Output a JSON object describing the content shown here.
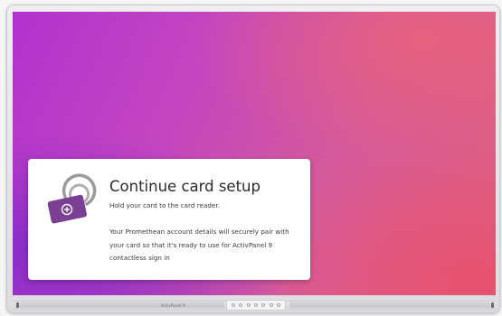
{
  "dialog": {
    "title": "Continue card setup",
    "subtitle": "Hold your card to the card reader.",
    "body": "Your Promethean account details will securely pair with your card so that it's ready to use for ActivPanel 9 contactless sign in",
    "icon": "nfc-card-icon"
  },
  "panel": {
    "brand_label": "ActivPanel 9"
  },
  "colors": {
    "card_purple": "#7b3f93",
    "gradient_start": "#b332cf",
    "gradient_end": "#e0607e",
    "card_background": "#ffffff"
  }
}
